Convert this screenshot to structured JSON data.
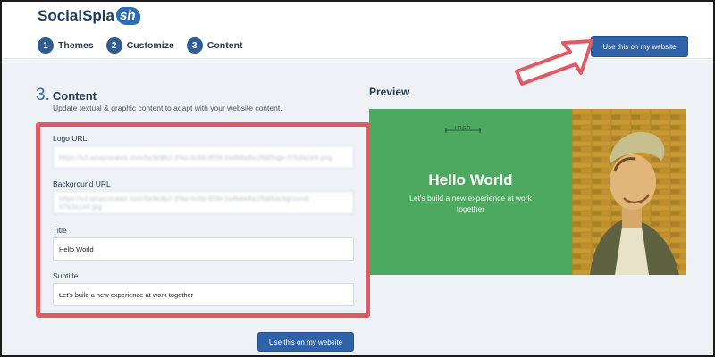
{
  "header": {
    "logo_text": "SocialSpla",
    "logo_badge": "sh",
    "steps": [
      {
        "num": "1",
        "label": "Themes"
      },
      {
        "num": "2",
        "label": "Customize"
      },
      {
        "num": "3",
        "label": "Content"
      }
    ],
    "cta_label": "Use this on my website"
  },
  "content": {
    "step_num": "3.",
    "heading": "Content",
    "description": "Update textual & graphic content to adapt with your website content.",
    "fields": [
      {
        "label": "Logo URL",
        "value": "https://s3.amazonaws.com/5e9e8b2-2f4a-4c6b-8f39-2a4b6e8a1f6d/logo-07b3a1e9.png"
      },
      {
        "label": "Background URL",
        "value": "https://s3.amazonaws.com/5e9e8b2-2f4a-4c6b-8f39-2a4b6e8a1f6d/background-07b3a1e9.jpg"
      },
      {
        "label": "Title",
        "value": "Hello World"
      },
      {
        "label": "Subtitle",
        "value": "Let's build a new experience at work together"
      }
    ],
    "bottom_cta_label": "Use this on my website"
  },
  "preview": {
    "heading": "Preview",
    "logo_placeholder": "LOGO",
    "title": "Hello World",
    "subtitle": "Let's build a new experience at work together"
  },
  "colors": {
    "accent": "#2f62a6",
    "highlight": "#e05a63",
    "preview_green": "#4ea960"
  }
}
